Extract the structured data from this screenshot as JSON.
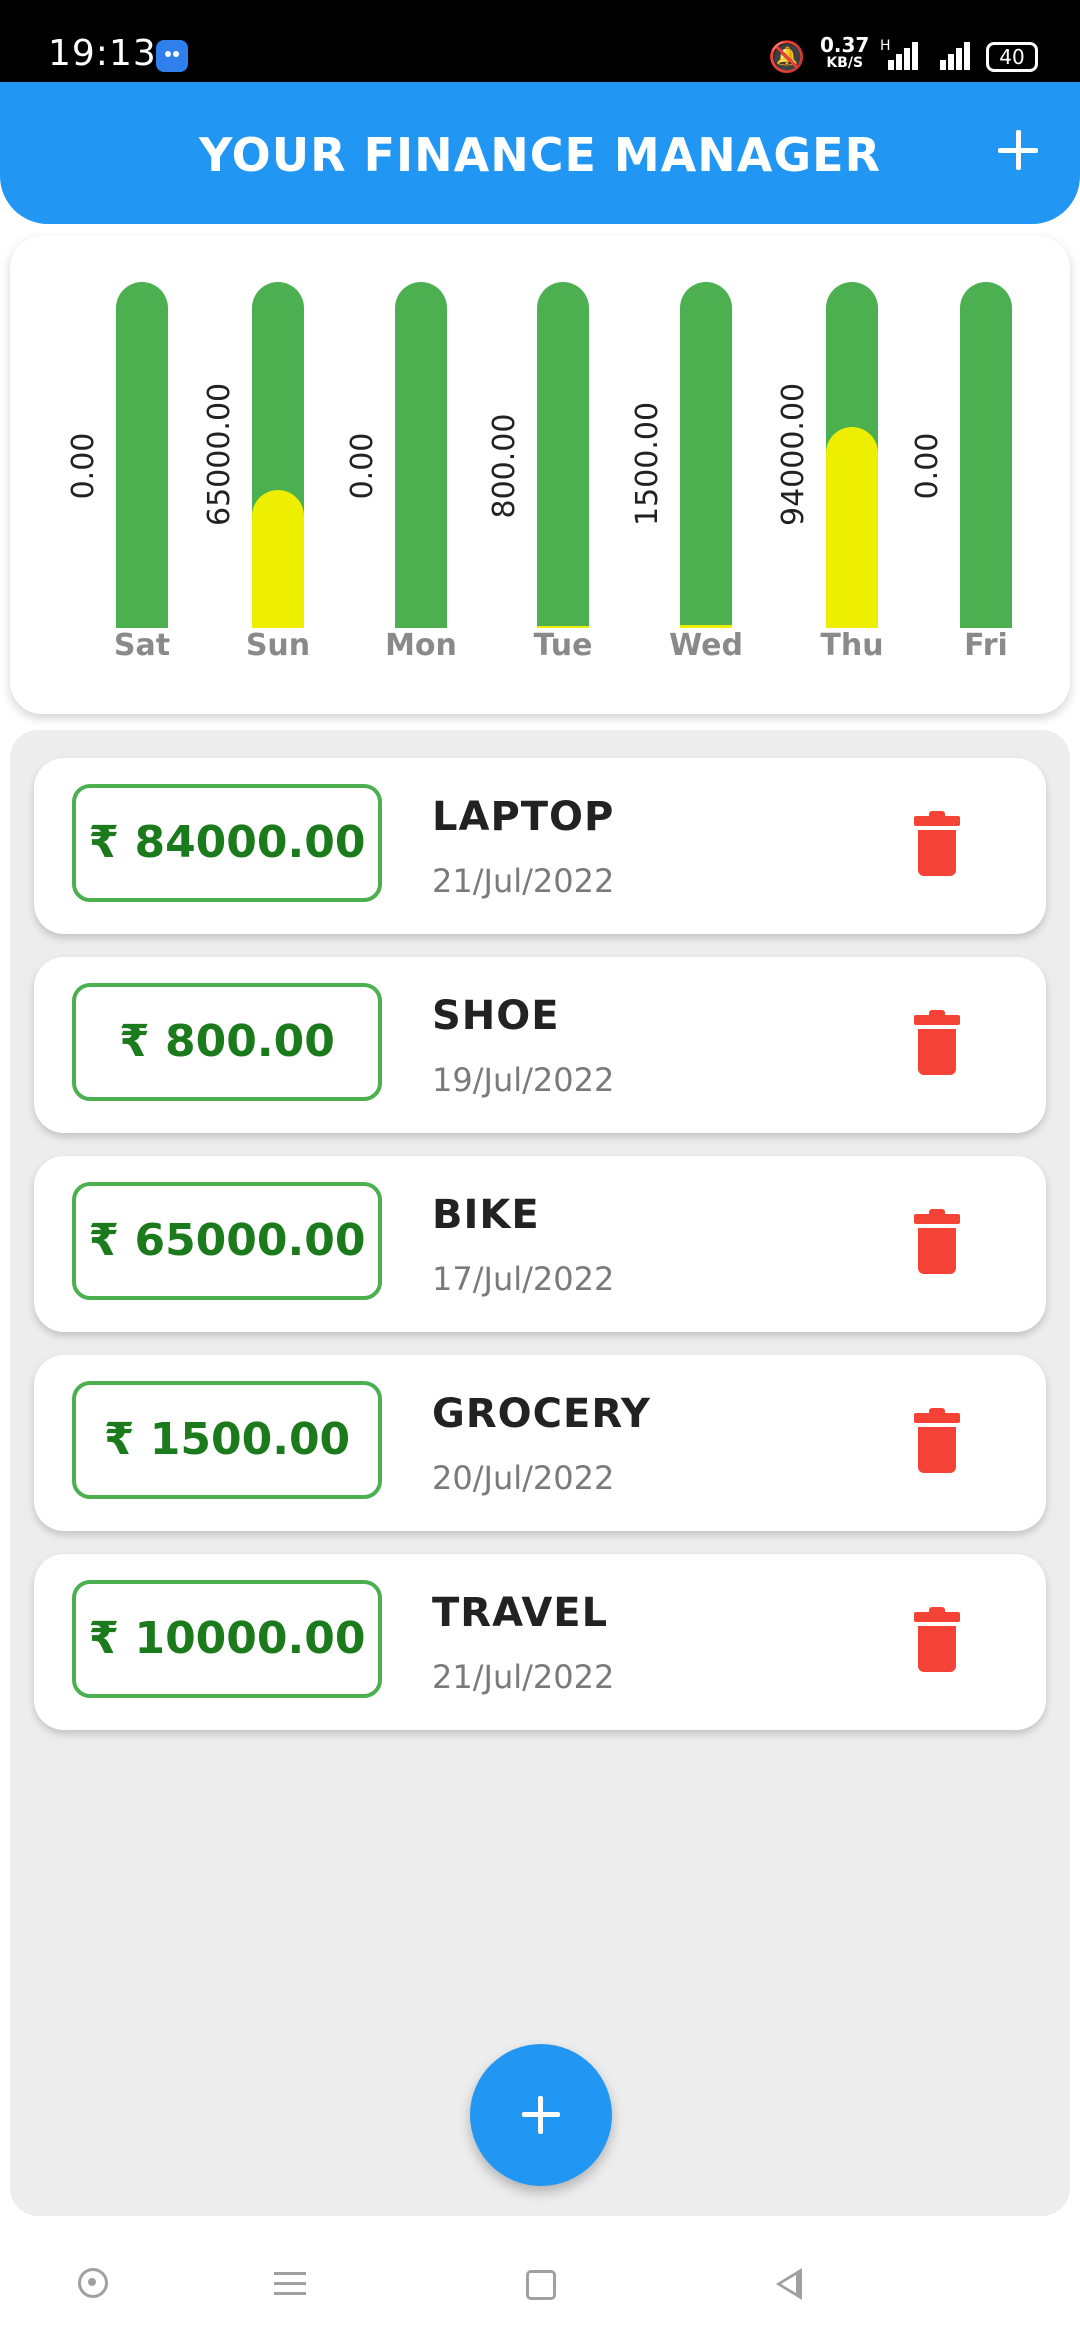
{
  "status_bar": {
    "time": "19:13",
    "speed_value": "0.37",
    "speed_unit": "KB/S",
    "network_type": "H",
    "battery": "40",
    "icons": [
      "android-app-icon",
      "mute-icon",
      "signal-icon",
      "signal-icon",
      "battery-icon"
    ]
  },
  "app_bar": {
    "title": "YOUR FINANCE MANAGER",
    "add_icon": "plus-icon"
  },
  "chart_data": {
    "type": "bar",
    "categories": [
      "Sat",
      "Sun",
      "Mon",
      "Tue",
      "Wed",
      "Thu",
      "Fri"
    ],
    "values": [
      0.0,
      65000.0,
      0.0,
      800.0,
      1500.0,
      94000.0,
      0.0
    ],
    "value_labels": [
      "0.00",
      "65000.00",
      "0.00",
      "800.00",
      "1500.00",
      "94000.00",
      "0.00"
    ],
    "fill_fraction": [
      0.0,
      0.4,
      0.0,
      0.005,
      0.01,
      0.58,
      0.0
    ],
    "title": "",
    "xlabel": "",
    "ylabel": "",
    "grid": false,
    "colors": {
      "track": "#4caf50",
      "fill": "#eeee00"
    }
  },
  "transactions": [
    {
      "amount": "₹ 84000.00",
      "title": "LAPTOP",
      "date": "21/Jul/2022"
    },
    {
      "amount": "₹ 800.00",
      "title": "SHOE",
      "date": "19/Jul/2022"
    },
    {
      "amount": "₹ 65000.00",
      "title": "BIKE",
      "date": "17/Jul/2022"
    },
    {
      "amount": "₹ 1500.00",
      "title": "GROCERY",
      "date": "20/Jul/2022"
    },
    {
      "amount": "₹ 10000.00",
      "title": "TRAVEL",
      "date": "21/Jul/2022"
    }
  ],
  "fab": {
    "icon": "plus-icon"
  },
  "nav_bar": {
    "icons": [
      "home-icon",
      "menu-icon",
      "recents-icon",
      "back-icon"
    ]
  },
  "colors": {
    "primary": "#2196f3",
    "amount_text": "#1b7a1b",
    "amount_border": "#4caf50",
    "delete": "#f44336"
  }
}
